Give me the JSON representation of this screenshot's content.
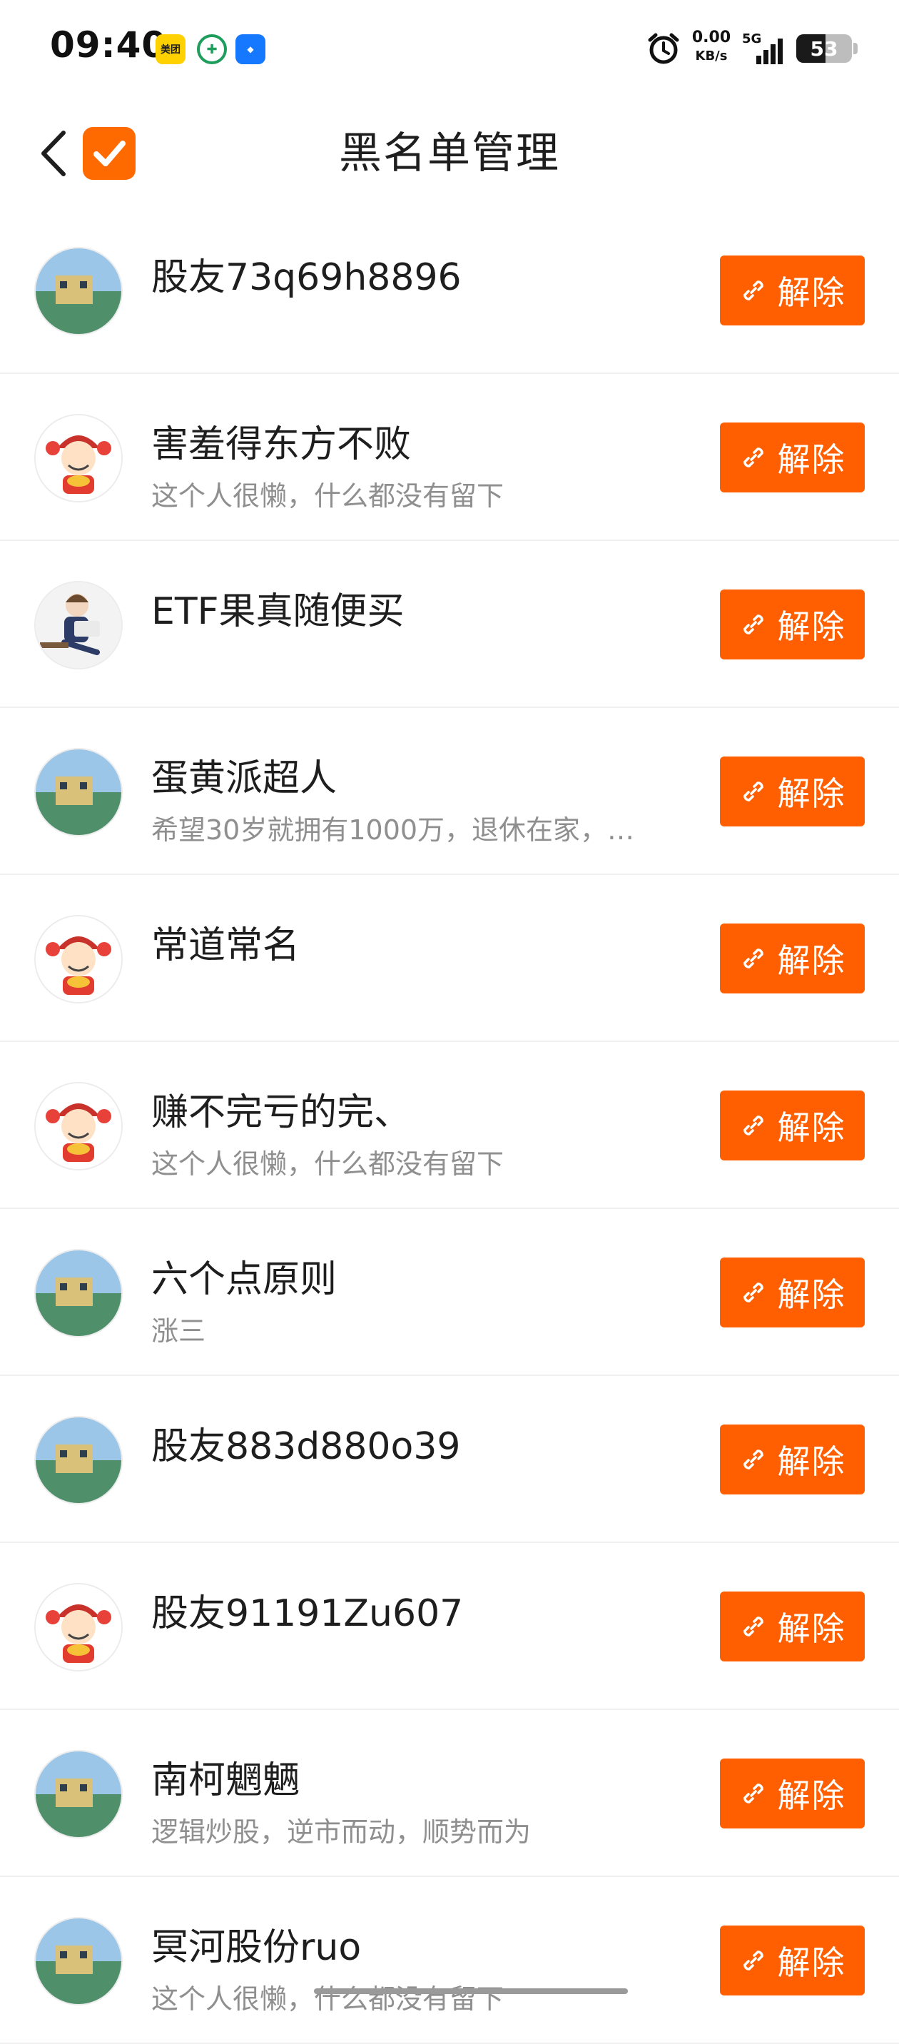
{
  "status_bar": {
    "time": "09:40",
    "apps": {
      "meituan": "美团"
    },
    "net_speed_value": "0.00",
    "net_speed_unit": "KB/s",
    "network": "5G",
    "battery_percent": 53,
    "battery_label": "53"
  },
  "header": {
    "title": "黑名单管理"
  },
  "unblock_label": "解除",
  "users": [
    {
      "name": "股友73q69h8896",
      "desc": "",
      "avatar": "photo-avatar"
    },
    {
      "name": "害羞得东方不败",
      "desc": "这个人很懒，什么都没有留下",
      "avatar": "mascot-avatar"
    },
    {
      "name": "ETF果真随便买",
      "desc": "",
      "avatar": "cartoon-avatar"
    },
    {
      "name": "蛋黄派超人",
      "desc": "希望30岁就拥有1000万，退休在家，…",
      "avatar": "photo-avatar"
    },
    {
      "name": "常道常名",
      "desc": "",
      "avatar": "mascot-avatar"
    },
    {
      "name": "赚不完亏的完、",
      "desc": "这个人很懒，什么都没有留下",
      "avatar": "mascot-avatar"
    },
    {
      "name": "六个点原则",
      "desc": "涨三",
      "avatar": "photo-avatar"
    },
    {
      "name": "股友883d880o39",
      "desc": "",
      "avatar": "photo-avatar"
    },
    {
      "name": "股友91191Zu607",
      "desc": "",
      "avatar": "mascot-avatar"
    },
    {
      "name": "南柯魍魉",
      "desc": "逻辑炒股，逆市而动，顺势而为",
      "avatar": "photo-avatar"
    },
    {
      "name": "冥河股份ruo",
      "desc": "这个人很懒，什么都没有留下",
      "avatar": "photo-avatar"
    }
  ],
  "colors": {
    "accent": "#ff5f00",
    "title_text": "#1e1e1e",
    "secondary_text": "#8f8f8f"
  }
}
